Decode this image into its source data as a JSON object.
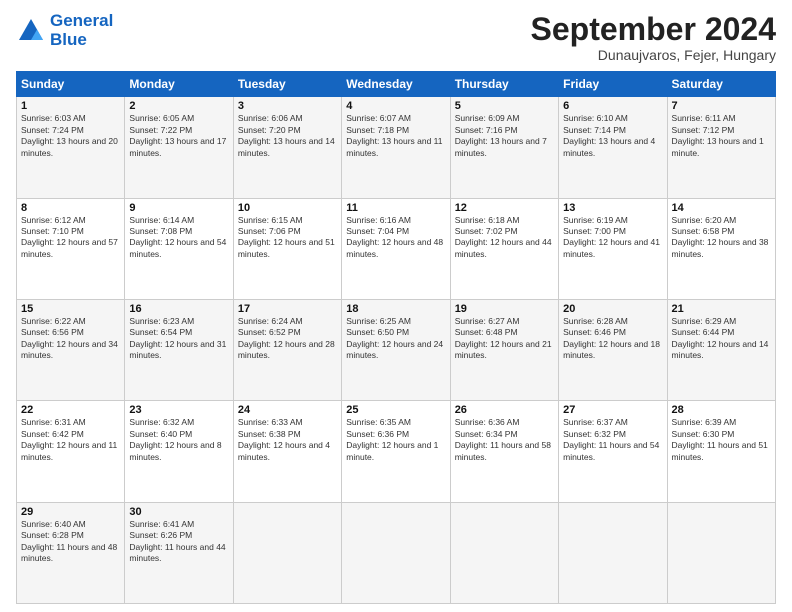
{
  "header": {
    "logo_line1": "General",
    "logo_line2": "Blue",
    "month": "September 2024",
    "location": "Dunaujvaros, Fejer, Hungary"
  },
  "weekdays": [
    "Sunday",
    "Monday",
    "Tuesday",
    "Wednesday",
    "Thursday",
    "Friday",
    "Saturday"
  ],
  "weeks": [
    [
      {
        "day": "1",
        "sunrise": "Sunrise: 6:03 AM",
        "sunset": "Sunset: 7:24 PM",
        "daylight": "Daylight: 13 hours and 20 minutes."
      },
      {
        "day": "2",
        "sunrise": "Sunrise: 6:05 AM",
        "sunset": "Sunset: 7:22 PM",
        "daylight": "Daylight: 13 hours and 17 minutes."
      },
      {
        "day": "3",
        "sunrise": "Sunrise: 6:06 AM",
        "sunset": "Sunset: 7:20 PM",
        "daylight": "Daylight: 13 hours and 14 minutes."
      },
      {
        "day": "4",
        "sunrise": "Sunrise: 6:07 AM",
        "sunset": "Sunset: 7:18 PM",
        "daylight": "Daylight: 13 hours and 11 minutes."
      },
      {
        "day": "5",
        "sunrise": "Sunrise: 6:09 AM",
        "sunset": "Sunset: 7:16 PM",
        "daylight": "Daylight: 13 hours and 7 minutes."
      },
      {
        "day": "6",
        "sunrise": "Sunrise: 6:10 AM",
        "sunset": "Sunset: 7:14 PM",
        "daylight": "Daylight: 13 hours and 4 minutes."
      },
      {
        "day": "7",
        "sunrise": "Sunrise: 6:11 AM",
        "sunset": "Sunset: 7:12 PM",
        "daylight": "Daylight: 13 hours and 1 minute."
      }
    ],
    [
      {
        "day": "8",
        "sunrise": "Sunrise: 6:12 AM",
        "sunset": "Sunset: 7:10 PM",
        "daylight": "Daylight: 12 hours and 57 minutes."
      },
      {
        "day": "9",
        "sunrise": "Sunrise: 6:14 AM",
        "sunset": "Sunset: 7:08 PM",
        "daylight": "Daylight: 12 hours and 54 minutes."
      },
      {
        "day": "10",
        "sunrise": "Sunrise: 6:15 AM",
        "sunset": "Sunset: 7:06 PM",
        "daylight": "Daylight: 12 hours and 51 minutes."
      },
      {
        "day": "11",
        "sunrise": "Sunrise: 6:16 AM",
        "sunset": "Sunset: 7:04 PM",
        "daylight": "Daylight: 12 hours and 48 minutes."
      },
      {
        "day": "12",
        "sunrise": "Sunrise: 6:18 AM",
        "sunset": "Sunset: 7:02 PM",
        "daylight": "Daylight: 12 hours and 44 minutes."
      },
      {
        "day": "13",
        "sunrise": "Sunrise: 6:19 AM",
        "sunset": "Sunset: 7:00 PM",
        "daylight": "Daylight: 12 hours and 41 minutes."
      },
      {
        "day": "14",
        "sunrise": "Sunrise: 6:20 AM",
        "sunset": "Sunset: 6:58 PM",
        "daylight": "Daylight: 12 hours and 38 minutes."
      }
    ],
    [
      {
        "day": "15",
        "sunrise": "Sunrise: 6:22 AM",
        "sunset": "Sunset: 6:56 PM",
        "daylight": "Daylight: 12 hours and 34 minutes."
      },
      {
        "day": "16",
        "sunrise": "Sunrise: 6:23 AM",
        "sunset": "Sunset: 6:54 PM",
        "daylight": "Daylight: 12 hours and 31 minutes."
      },
      {
        "day": "17",
        "sunrise": "Sunrise: 6:24 AM",
        "sunset": "Sunset: 6:52 PM",
        "daylight": "Daylight: 12 hours and 28 minutes."
      },
      {
        "day": "18",
        "sunrise": "Sunrise: 6:25 AM",
        "sunset": "Sunset: 6:50 PM",
        "daylight": "Daylight: 12 hours and 24 minutes."
      },
      {
        "day": "19",
        "sunrise": "Sunrise: 6:27 AM",
        "sunset": "Sunset: 6:48 PM",
        "daylight": "Daylight: 12 hours and 21 minutes."
      },
      {
        "day": "20",
        "sunrise": "Sunrise: 6:28 AM",
        "sunset": "Sunset: 6:46 PM",
        "daylight": "Daylight: 12 hours and 18 minutes."
      },
      {
        "day": "21",
        "sunrise": "Sunrise: 6:29 AM",
        "sunset": "Sunset: 6:44 PM",
        "daylight": "Daylight: 12 hours and 14 minutes."
      }
    ],
    [
      {
        "day": "22",
        "sunrise": "Sunrise: 6:31 AM",
        "sunset": "Sunset: 6:42 PM",
        "daylight": "Daylight: 12 hours and 11 minutes."
      },
      {
        "day": "23",
        "sunrise": "Sunrise: 6:32 AM",
        "sunset": "Sunset: 6:40 PM",
        "daylight": "Daylight: 12 hours and 8 minutes."
      },
      {
        "day": "24",
        "sunrise": "Sunrise: 6:33 AM",
        "sunset": "Sunset: 6:38 PM",
        "daylight": "Daylight: 12 hours and 4 minutes."
      },
      {
        "day": "25",
        "sunrise": "Sunrise: 6:35 AM",
        "sunset": "Sunset: 6:36 PM",
        "daylight": "Daylight: 12 hours and 1 minute."
      },
      {
        "day": "26",
        "sunrise": "Sunrise: 6:36 AM",
        "sunset": "Sunset: 6:34 PM",
        "daylight": "Daylight: 11 hours and 58 minutes."
      },
      {
        "day": "27",
        "sunrise": "Sunrise: 6:37 AM",
        "sunset": "Sunset: 6:32 PM",
        "daylight": "Daylight: 11 hours and 54 minutes."
      },
      {
        "day": "28",
        "sunrise": "Sunrise: 6:39 AM",
        "sunset": "Sunset: 6:30 PM",
        "daylight": "Daylight: 11 hours and 51 minutes."
      }
    ],
    [
      {
        "day": "29",
        "sunrise": "Sunrise: 6:40 AM",
        "sunset": "Sunset: 6:28 PM",
        "daylight": "Daylight: 11 hours and 48 minutes."
      },
      {
        "day": "30",
        "sunrise": "Sunrise: 6:41 AM",
        "sunset": "Sunset: 6:26 PM",
        "daylight": "Daylight: 11 hours and 44 minutes."
      },
      null,
      null,
      null,
      null,
      null
    ]
  ]
}
